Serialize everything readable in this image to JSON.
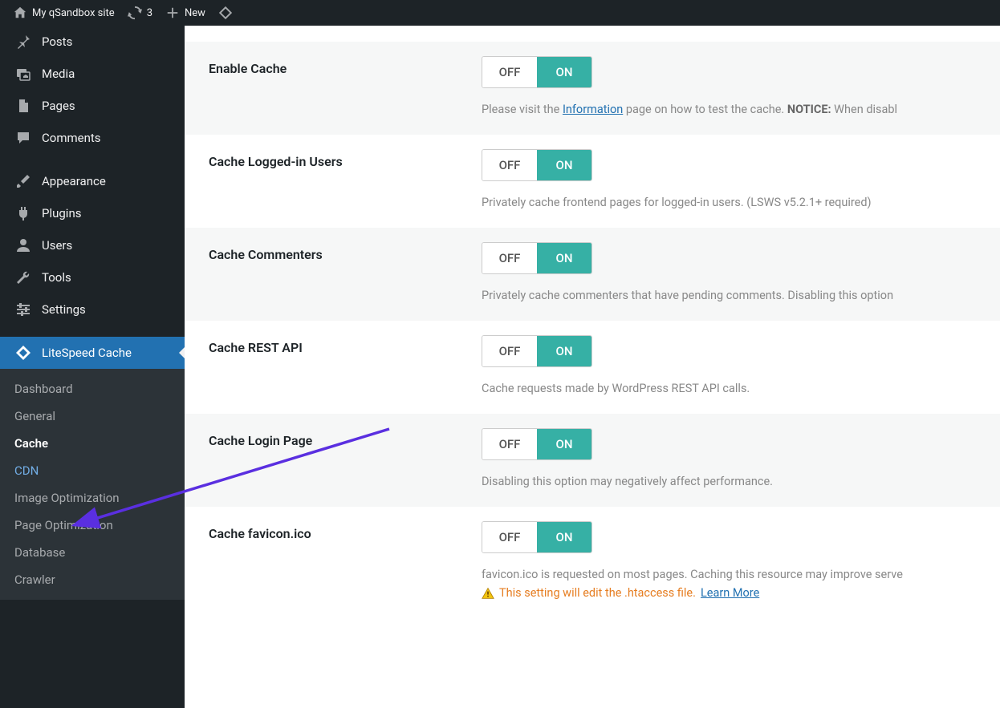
{
  "adminbar": {
    "site_name": "My qSandbox site",
    "updates_count": "3",
    "new_label": "New"
  },
  "sidebar": {
    "main": [
      {
        "id": "posts",
        "label": "Posts",
        "icon": "pin"
      },
      {
        "id": "media",
        "label": "Media",
        "icon": "media"
      },
      {
        "id": "pages",
        "label": "Pages",
        "icon": "page"
      },
      {
        "id": "comments",
        "label": "Comments",
        "icon": "comment"
      }
    ],
    "admin": [
      {
        "id": "appearance",
        "label": "Appearance",
        "icon": "brush"
      },
      {
        "id": "plugins",
        "label": "Plugins",
        "icon": "plug"
      },
      {
        "id": "users",
        "label": "Users",
        "icon": "user"
      },
      {
        "id": "tools",
        "label": "Tools",
        "icon": "wrench"
      },
      {
        "id": "settings",
        "label": "Settings",
        "icon": "sliders"
      }
    ],
    "litespeed": {
      "label": "LiteSpeed Cache",
      "items": [
        {
          "id": "dashboard",
          "label": "Dashboard"
        },
        {
          "id": "general",
          "label": "General"
        },
        {
          "id": "cache",
          "label": "Cache",
          "current": true
        },
        {
          "id": "cdn",
          "label": "CDN",
          "hover": true
        },
        {
          "id": "image-optimization",
          "label": "Image Optimization"
        },
        {
          "id": "page-optimization",
          "label": "Page Optimization"
        },
        {
          "id": "database",
          "label": "Database"
        },
        {
          "id": "crawler",
          "label": "Crawler"
        }
      ]
    }
  },
  "toggle": {
    "off": "OFF",
    "on": "ON"
  },
  "settings": [
    {
      "id": "enable-cache",
      "label": "Enable Cache",
      "value": "on",
      "shade": true,
      "desc_pre": "Please visit the ",
      "desc_link": "Information",
      "desc_mid": " page on how to test the cache. ",
      "desc_bold": "NOTICE:",
      "desc_post": " When disabl"
    },
    {
      "id": "cache-logged-in",
      "label": "Cache Logged-in Users",
      "value": "on",
      "shade": false,
      "desc": "Privately cache frontend pages for logged-in users. (LSWS v5.2.1+ required)"
    },
    {
      "id": "cache-commenters",
      "label": "Cache Commenters",
      "value": "on",
      "shade": true,
      "desc": "Privately cache commenters that have pending comments. Disabling this option "
    },
    {
      "id": "cache-rest-api",
      "label": "Cache REST API",
      "value": "on",
      "shade": false,
      "desc": "Cache requests made by WordPress REST API calls."
    },
    {
      "id": "cache-login-page",
      "label": "Cache Login Page",
      "value": "on",
      "shade": true,
      "desc": "Disabling this option may negatively affect performance."
    },
    {
      "id": "cache-favicon",
      "label": "Cache favicon.ico",
      "value": "on",
      "shade": false,
      "desc": "favicon.ico is requested on most pages. Caching this resource may improve serve",
      "warn_text": "This setting will edit the .htaccess file.",
      "warn_link": "Learn More"
    }
  ]
}
